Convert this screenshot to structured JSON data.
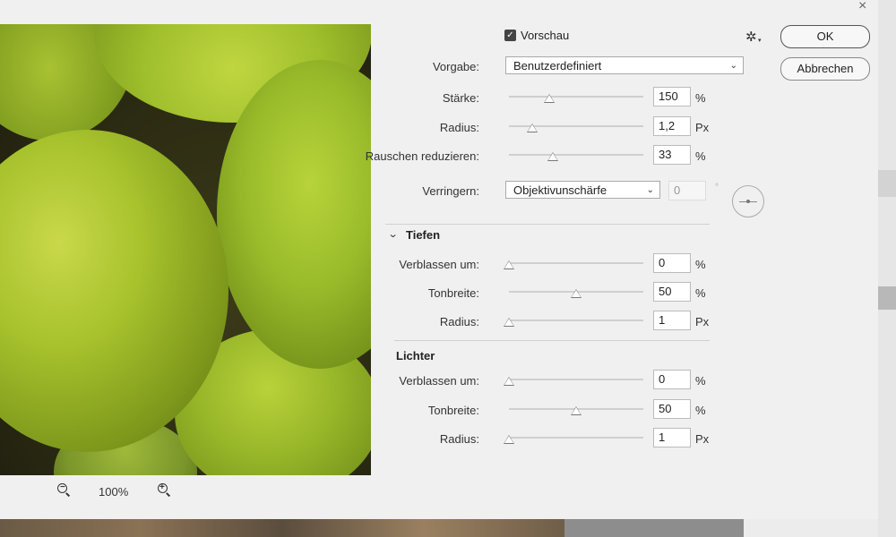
{
  "window": {
    "close_icon": "close-icon"
  },
  "preview_panel": {
    "zoom_out_icon": "zoom-out-icon",
    "zoom_in_icon": "zoom-in-icon",
    "zoom_level": "100%"
  },
  "header": {
    "preview_checkbox_checked": true,
    "preview_label": "Vorschau",
    "settings_icon": "gear-icon"
  },
  "buttons": {
    "ok": "OK",
    "cancel": "Abbrechen"
  },
  "preset": {
    "label": "Vorgabe:",
    "value": "Benutzerdefiniert"
  },
  "main_controls": [
    {
      "label": "Stärke:",
      "value": "150",
      "unit": "%",
      "slider_fraction": 0.3
    },
    {
      "label": "Radius:",
      "value": "1,2",
      "unit": "Px",
      "slider_fraction": 0.18
    },
    {
      "label": "Rauschen reduzieren:",
      "value": "33",
      "unit": "%",
      "slider_fraction": 0.33
    }
  ],
  "reduce": {
    "label": "Verringern:",
    "value": "Objektivunschärfe",
    "angle": "0",
    "angle_unit": "°"
  },
  "shadows": {
    "title": "Tiefen",
    "controls": [
      {
        "label": "Verblassen um:",
        "value": "0",
        "unit": "%",
        "slider_fraction": 0
      },
      {
        "label": "Tonbreite:",
        "value": "50",
        "unit": "%",
        "slider_fraction": 0.5
      },
      {
        "label": "Radius:",
        "value": "1",
        "unit": "Px",
        "slider_fraction": 0
      }
    ]
  },
  "highlights": {
    "title": "Lichter",
    "controls": [
      {
        "label": "Verblassen um:",
        "value": "0",
        "unit": "%",
        "slider_fraction": 0
      },
      {
        "label": "Tonbreite:",
        "value": "50",
        "unit": "%",
        "slider_fraction": 0.5
      },
      {
        "label": "Radius:",
        "value": "1",
        "unit": "Px",
        "slider_fraction": 0
      }
    ]
  }
}
